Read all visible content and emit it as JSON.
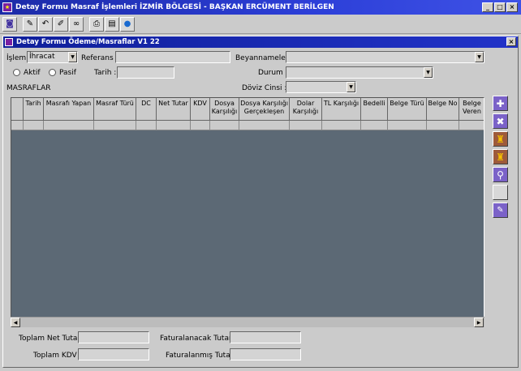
{
  "window": {
    "title": "Detay Formu Masraf İşlemleri  İZMİR BÖLGESİ - BAŞKAN ERCÜMENT BERİLGEN",
    "minimize": "_",
    "maximize": "□",
    "close": "×"
  },
  "inner": {
    "title": "Detay Formu Ödeme/Masraflar V1 22",
    "close": "×"
  },
  "form": {
    "islem_label": "İşlem :",
    "islem_value": "İhracat",
    "referans_label": "Referans :",
    "beyanname_label": "Beyannameler :",
    "aktif_label": "Aktif",
    "pasif_label": "Pasif",
    "tarih_label": "Tarih :",
    "durum_label": "Durum :",
    "masraflar_label": "MASRAFLAR",
    "doviz_label": "Döviz Cinsi :"
  },
  "table": {
    "columns": [
      "Tarih",
      "Masrafı Yapan",
      "Masraf Türü",
      "DC",
      "Net Tutar",
      "KDV",
      "Dosya Karşılığı",
      "Dosya Karşılığı Gerçekleşen",
      "Dolar Karşılığı",
      "TL Karşılığı",
      "Bedelli",
      "Belge Türü",
      "Belge No",
      "Belge Veren"
    ]
  },
  "totals": {
    "toplam_net": "Toplam Net Tutar :",
    "toplam_kdv": "Toplam KDV :",
    "faturalanacak": "Faturalanacak Tutar :",
    "faturalanmis": "Faturalanmış Tutar :"
  },
  "colors": {
    "title_bar": "#1c2ba8",
    "grid_bg": "#5c6975",
    "side_button": "#7b62c8"
  }
}
